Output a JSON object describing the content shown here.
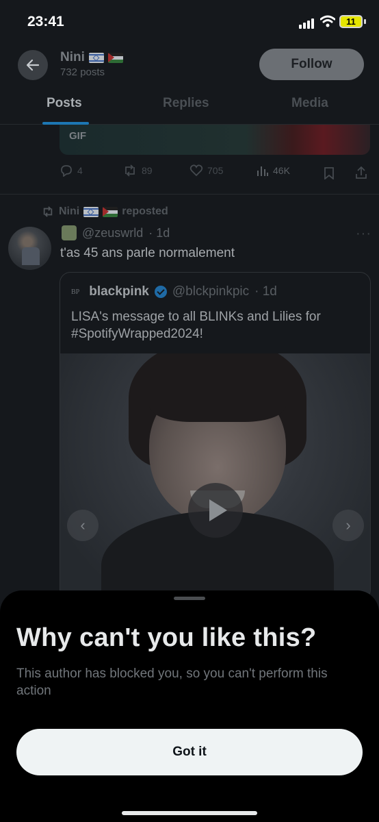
{
  "status_bar": {
    "time": "23:41",
    "battery": "11"
  },
  "header": {
    "name": "Nini",
    "posts_count": "732 posts",
    "follow_label": "Follow"
  },
  "tabs": [
    {
      "label": "Posts"
    },
    {
      "label": "Replies"
    },
    {
      "label": "Media"
    }
  ],
  "prev_post": {
    "gif_label": "GIF",
    "replies": "4",
    "reposts": "89",
    "likes": "705",
    "views": "46K"
  },
  "repost": {
    "reposter": "Nini",
    "label": "reposted",
    "author_handle": "@zeuswrld",
    "time": "· 1d",
    "text": "t'as 45 ans parle normalement",
    "quote": {
      "logo": "BP",
      "name": "blackpink",
      "handle": "@blckpinkpic",
      "time": "· 1d",
      "text": "LISA's message to all BLINKs and Lilies for #SpotifyWrapped2024!"
    }
  },
  "sheet": {
    "title": "Why can't you like this?",
    "body": "This author has blocked you, so you can't perform this action",
    "button_label": "Got it"
  },
  "colors": {
    "accent": "#1d9bf0",
    "sheet_bg": "#000000",
    "button_bg": "#eff3f4"
  },
  "icons": [
    "back-arrow-icon",
    "signal-icon",
    "wifi-icon",
    "battery-icon",
    "reply-icon",
    "repost-icon",
    "like-icon",
    "views-icon",
    "bookmark-icon",
    "share-icon",
    "verified-icon",
    "play-icon",
    "chevron-left-icon",
    "chevron-right-icon",
    "more-icon"
  ]
}
